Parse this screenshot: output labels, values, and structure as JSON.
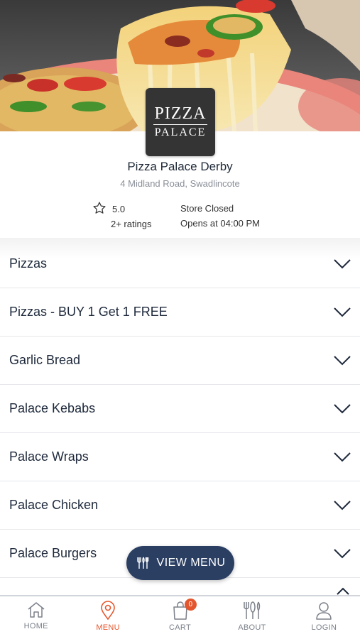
{
  "store": {
    "logo_line1": "PIZZA",
    "logo_line2": "PALACE",
    "name": "Pizza Palace Derby",
    "address": "4 Midland Road, Swadlincote",
    "rating": "5.0",
    "rating_count": "2+ ratings",
    "status": "Store Closed",
    "opens": "Opens at 04:00 PM"
  },
  "categories": [
    {
      "label": "Pizzas"
    },
    {
      "label": "Pizzas - BUY 1 Get 1 FREE"
    },
    {
      "label": "Garlic Bread"
    },
    {
      "label": "Palace Kebabs"
    },
    {
      "label": "Palace Wraps"
    },
    {
      "label": "Palace Chicken"
    },
    {
      "label": "Palace Burgers"
    }
  ],
  "view_menu_label": "VIEW MENU",
  "nav": {
    "home": "HOME",
    "menu": "MENU",
    "cart": "CART",
    "cart_count": "0",
    "about": "ABOUT",
    "login": "LOGIN"
  },
  "colors": {
    "accent": "#e4572e",
    "button": "#2b3f63"
  }
}
